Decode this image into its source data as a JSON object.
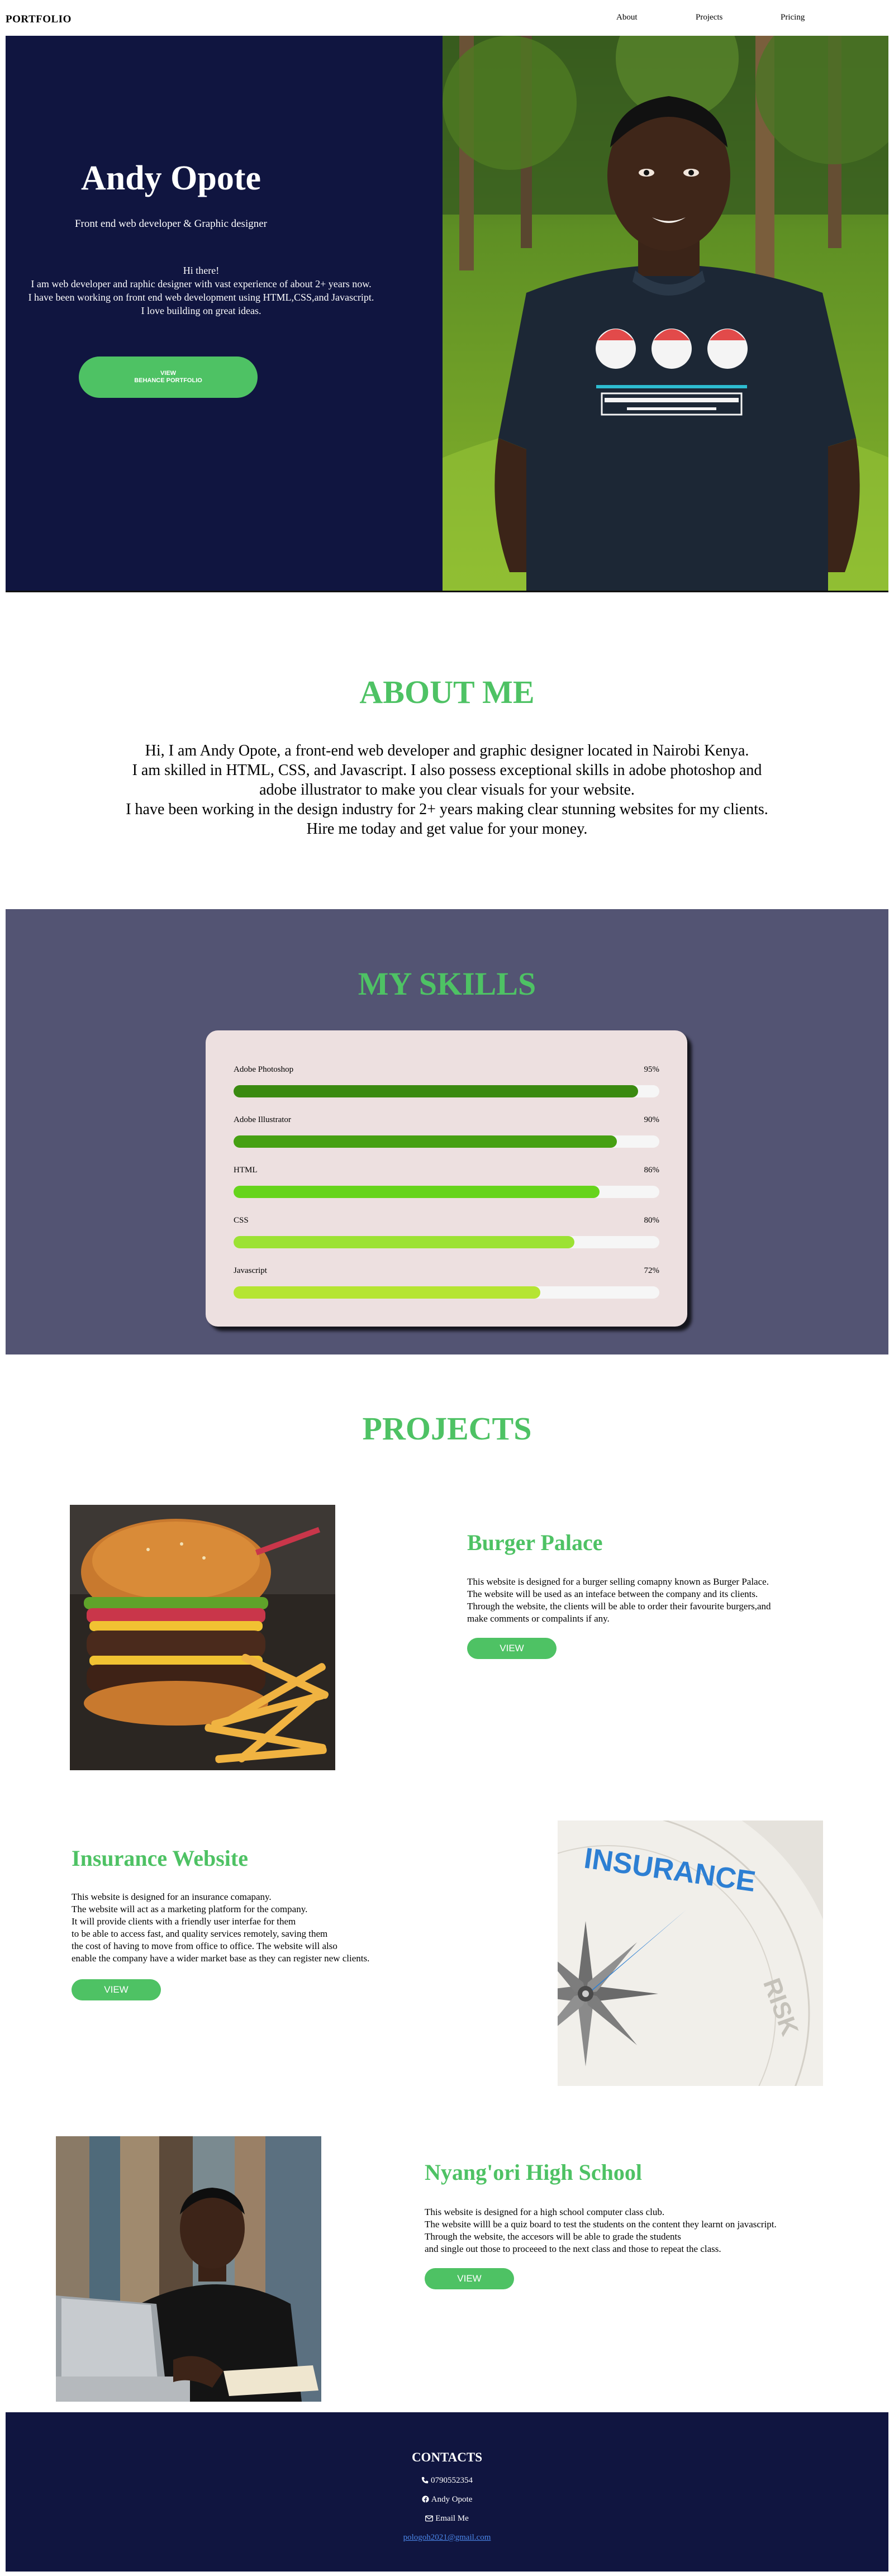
{
  "nav": {
    "brand": "PORTFOLIO",
    "links": [
      "About",
      "Projects",
      "Pricing"
    ]
  },
  "hero": {
    "name": "Andy Opote",
    "tagline": "Front end web developer & Graphic designer",
    "bio": [
      "Hi there!",
      "I am web developer and raphic designer with vast experience of about 2+ years now.",
      "I have been working on front end web development using HTML,CSS,and Javascript.",
      "I love building on great ideas."
    ],
    "button_line1": "VIEW",
    "button_line2": "BEHANCE PORTFOLIO",
    "photo_icon": "portrait-photo"
  },
  "about": {
    "title": "ABOUT ME",
    "lines": [
      "Hi, I am Andy Opote, a front-end web developer and graphic designer located in Nairobi Kenya.",
      "I am skilled in HTML, CSS, and Javascript. I also possess exceptional skills in adobe photoshop and",
      "adobe illustrator to make you clear visuals for your website.",
      "I have been working in the design industry for 2+ years making clear stunning websites for my clients.",
      "Hire me today and get value for your money."
    ]
  },
  "skills": {
    "title": "MY SKILLS",
    "items": [
      {
        "name": "Adobe Photoshop",
        "label": "95%",
        "percent": 95,
        "color": "#3a8a10"
      },
      {
        "name": "Adobe Illustrator",
        "label": "90%",
        "percent": 90,
        "color": "#46a012"
      },
      {
        "name": "HTML",
        "label": "86%",
        "percent": 86,
        "color": "#66d41c"
      },
      {
        "name": "CSS",
        "label": "80%",
        "percent": 80,
        "color": "#9ce234"
      },
      {
        "name": "Javascript",
        "label": "72%",
        "percent": 72,
        "color": "#b5e532"
      }
    ]
  },
  "projects": {
    "title": "PROJECTS",
    "items": [
      {
        "title": "Burger Palace",
        "description": "This website is designed for a burger selling comapny known as Burger Palace.\nThe website will be used as an inteface between the company and its clients.\nThrough the website, the clients will be able to order their favourite burgers,and\nmake comments or compalints if any.",
        "button": "VIEW",
        "image": "burger-photo"
      },
      {
        "title": "Insurance Website",
        "description": "This website is designed for an insurance comapany.\nThe website will act as a marketing platform for the company.\nIt will provide clients with a friendly user interfae for them\nto be able to access fast, and quality services remotely, saving them\nthe cost of having to move from office to office. The website will also\nenable the company have a wider market base as they can register new clients.",
        "button": "VIEW",
        "image": "insurance-compass-photo",
        "image_text": "INSURANCE",
        "image_text2": "RISK"
      },
      {
        "title": "Nyang'ori High School",
        "description": "This website is designed for a high school computer class club.\nThe website willl be a quiz board to test the students on the content they learnt on javascript.\nThrough the website, the accesors will be able to grade the students\nand single out those to proceeed to the next class and those to repeat the class.",
        "button": "VIEW",
        "image": "student-laptop-photo"
      }
    ]
  },
  "footer": {
    "title": "CONTACTS",
    "phone": "0790552354",
    "facebook": "Andy Opote",
    "email_label": "Email Me",
    "email": "pologoh2021@gmail.com"
  },
  "colors": {
    "navy": "#101540",
    "accent": "#4ec264",
    "skills_bg": "#535473",
    "card_bg": "#ede0e0"
  }
}
